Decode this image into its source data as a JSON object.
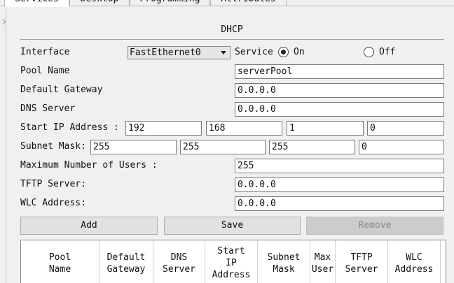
{
  "tabs": [
    {
      "label": "Services"
    },
    {
      "label": "Desktop"
    },
    {
      "label": "Programming"
    },
    {
      "label": "Attributes"
    }
  ],
  "dhcp": {
    "title": "DHCP",
    "interface_label": "Interface",
    "interface_value": "FastEthernet0",
    "service_label": "Service",
    "on_label": "On",
    "off_label": "Off",
    "service_state": "On",
    "pool_name_label": "Pool Name",
    "pool_name_value": "serverPool",
    "default_gateway_label": "Default Gateway",
    "default_gateway_value": "0.0.0.0",
    "dns_server_label": "DNS Server",
    "dns_server_value": "0.0.0.0",
    "start_ip_label": "Start IP Address :",
    "start_ip": [
      "192",
      "168",
      "1",
      "0"
    ],
    "subnet_mask_label": "Subnet Mask:",
    "subnet_mask": [
      "255",
      "255",
      "255",
      "0"
    ],
    "max_users_label": "Maximum Number of Users :",
    "max_users_value": "255",
    "tftp_label": "TFTP Server:",
    "tftp_value": "0.0.0.0",
    "wlc_label": "WLC Address:",
    "wlc_value": "0.0.0.0"
  },
  "buttons": {
    "add": "Add",
    "save": "Save",
    "remove": "Remove"
  },
  "table": {
    "headers": [
      "Pool\nName",
      "Default\nGateway",
      "DNS\nServer",
      "Start\nIP\nAddress",
      "Subnet\nMask",
      "Max\nUser",
      "TFTP\nServer",
      "WLC\nAddress"
    ]
  }
}
